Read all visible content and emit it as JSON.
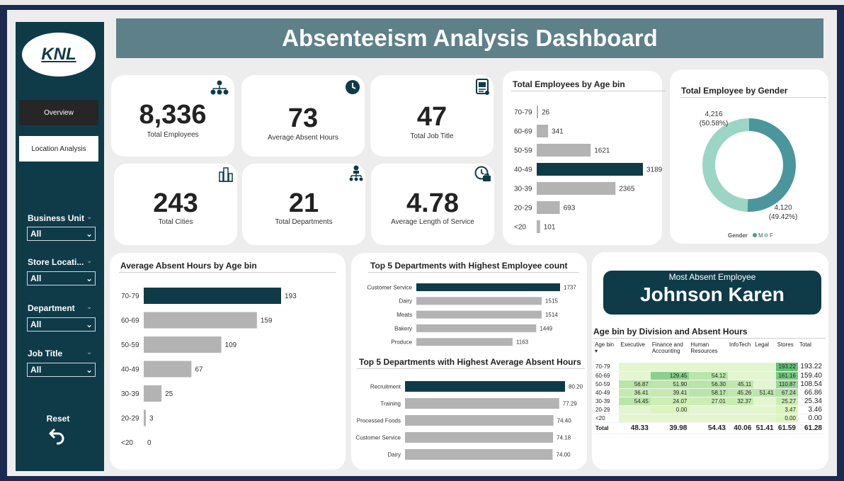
{
  "colors": {
    "accent": "#0f3b49",
    "bar": "#b3b3b3",
    "donut_m": "#4a969c",
    "donut_f": "#9cd5c3",
    "header": "#5e8089"
  },
  "sidebar": {
    "logo": "KNL",
    "nav": [
      {
        "label": "Overview"
      },
      {
        "label": "Location Analysis"
      }
    ],
    "filters": [
      {
        "label": "Business Unit",
        "value": "All"
      },
      {
        "label": "Store Locati...",
        "value": "All"
      },
      {
        "label": "Department",
        "value": "All"
      },
      {
        "label": "Job Title",
        "value": "All"
      }
    ],
    "reset_label": "Reset"
  },
  "header": {
    "title": "Absenteeism Analysis Dashboard"
  },
  "kpis": [
    {
      "value": "8,336",
      "label": "Total Employees",
      "icon": "org-chart-icon"
    },
    {
      "value": "73",
      "label": "Average Absent Hours",
      "icon": "clock-icon"
    },
    {
      "value": "47",
      "label": "Total Job Title",
      "icon": "id-card-icon"
    },
    {
      "value": "243",
      "label": "Total Cities",
      "icon": "city-icon"
    },
    {
      "value": "21",
      "label": "Total Departments",
      "icon": "hierarchy-icon"
    },
    {
      "value": "4.78",
      "label": "Average Length of Service",
      "icon": "briefcase-clock-icon"
    }
  ],
  "most_absent": {
    "title": "Most Absent Employee",
    "name": "Johnson Karen"
  },
  "chart_data": [
    {
      "id": "age",
      "type": "bar",
      "orientation": "horizontal",
      "title": "Total Employees by Age bin",
      "categories": [
        "70-79",
        "60-69",
        "50-59",
        "40-49",
        "30-39",
        "20-29",
        "<20"
      ],
      "values": [
        26,
        341,
        1621,
        3189,
        2365,
        693,
        101
      ],
      "highlight": "40-49"
    },
    {
      "id": "gender",
      "type": "pie",
      "title": "Total Employee by Gender",
      "legend_title": "Gender",
      "labels": [
        "M",
        "F"
      ],
      "values": [
        4216,
        4120
      ],
      "value_labels": [
        "4,216",
        "4,120"
      ],
      "percent_labels": [
        "(50.58%)",
        "(49.42%)"
      ]
    },
    {
      "id": "absent",
      "type": "bar",
      "orientation": "horizontal",
      "title": "Average Absent Hours by Age bin",
      "categories": [
        "70-79",
        "60-69",
        "50-59",
        "40-49",
        "30-39",
        "20-29",
        "<20"
      ],
      "values": [
        193,
        159,
        109,
        67,
        25,
        3,
        0
      ],
      "highlight": "70-79"
    },
    {
      "id": "dept_count",
      "type": "bar",
      "orientation": "horizontal",
      "title": "Top 5 Departments with Highest Employee count",
      "categories": [
        "Customer Service",
        "Dairy",
        "Meats",
        "Bakery",
        "Produce"
      ],
      "values": [
        1737,
        1515,
        1514,
        1449,
        1163
      ],
      "highlight": "Customer Service"
    },
    {
      "id": "dept_absent",
      "type": "bar",
      "orientation": "horizontal",
      "title": "Top 5 Departments with Highest Average Absent Hours",
      "categories": [
        "Recruitment",
        "Training",
        "Processed Foods",
        "Customer Service",
        "Dairy"
      ],
      "values": [
        80.2,
        77.29,
        74.4,
        74.18,
        74.0
      ],
      "value_labels": [
        "80.20",
        "77.29",
        "74.40",
        "74.18",
        "74.00"
      ],
      "highlight": "Recruitment"
    },
    {
      "id": "matrix",
      "type": "heatmap",
      "title": "Age bin by Division and Absent Hours",
      "corner": "Age bin",
      "columns": [
        "Executive",
        "Finance and Accounting",
        "Human Resources",
        "InfoTech",
        "Legal",
        "Stores",
        "Total"
      ],
      "rows": [
        {
          "label": "70-79",
          "cells": [
            "",
            "",
            "",
            "",
            "",
            "193.22"
          ],
          "total": "193.22"
        },
        {
          "label": "60-69",
          "cells": [
            "",
            "129.45",
            "54.12",
            "",
            "",
            "161.16"
          ],
          "total": "159.40"
        },
        {
          "label": "50-59",
          "cells": [
            "56.87",
            "51.90",
            "56.30",
            "45.11",
            "",
            "110.87"
          ],
          "total": "108.54"
        },
        {
          "label": "40-49",
          "cells": [
            "36.41",
            "39.41",
            "58.17",
            "45.26",
            "51.41",
            "67.24"
          ],
          "total": "66.86"
        },
        {
          "label": "30-39",
          "cells": [
            "54.45",
            "24.07",
            "27.01",
            "32.37",
            "",
            "25.27"
          ],
          "total": "25.34"
        },
        {
          "label": "20-29",
          "cells": [
            "",
            "0.00",
            "",
            "",
            "",
            "3.47"
          ],
          "total": "3.46"
        },
        {
          "label": "<20",
          "cells": [
            "",
            "",
            "",
            "",
            "",
            "0.00"
          ],
          "total": "0.00"
        }
      ],
      "totals": {
        "label": "Total",
        "cells": [
          "48.33",
          "39.98",
          "54.43",
          "40.06",
          "51.41",
          "61.59"
        ],
        "total": "61.28"
      }
    }
  ]
}
